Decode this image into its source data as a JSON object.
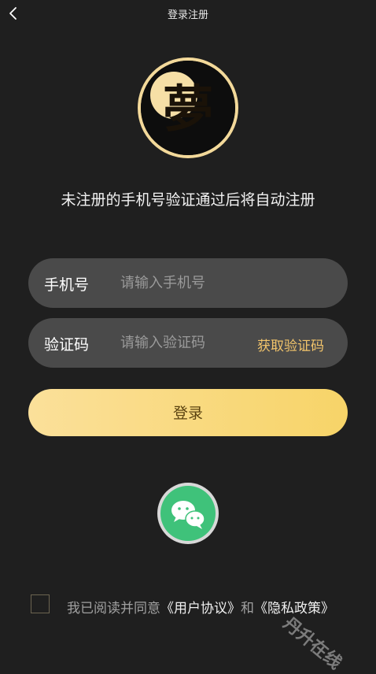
{
  "header": {
    "title": "登录注册",
    "back_icon": "chevron-left-icon"
  },
  "logo": {
    "name": "dream-logo",
    "glyph": "夢"
  },
  "tagline": "未注册的手机号验证通过后将自动注册",
  "phone_field": {
    "label": "手机号",
    "placeholder": "请输入手机号",
    "value": ""
  },
  "code_field": {
    "label": "验证码",
    "placeholder": "请输入验证码",
    "value": "",
    "action_label": "获取验证码"
  },
  "login_button": {
    "label": "登录"
  },
  "social": {
    "wechat_icon": "wechat-icon"
  },
  "agreement": {
    "prefix": "我已阅读并同意",
    "user_agreement": "《用户协议》",
    "conjunction": "和",
    "privacy_policy": "《隐私政策》",
    "checked": false
  },
  "watermark": "丹升在线",
  "colors": {
    "background": "#1f1f1f",
    "field_bg": "#4a4a4a",
    "accent": "#f2c46b",
    "button_gradient_start": "#fbe09a",
    "button_gradient_end": "#f7d468",
    "wechat_green": "#3fc27a"
  }
}
